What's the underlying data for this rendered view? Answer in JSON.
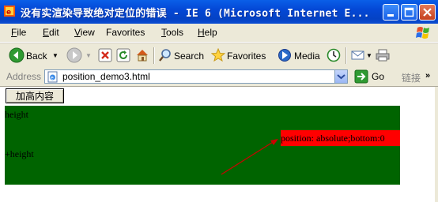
{
  "window": {
    "title": "没有实渲染导致绝对定位的错误 - IE 6 (Microsoft Internet E..."
  },
  "menu": {
    "items": [
      {
        "accel": "F",
        "rest": "ile"
      },
      {
        "accel": "E",
        "rest": "dit"
      },
      {
        "accel": "V",
        "rest": "iew"
      },
      {
        "accel": "",
        "rest": "Favorites"
      },
      {
        "accel": "T",
        "rest": "ools"
      },
      {
        "accel": "H",
        "rest": "elp"
      }
    ]
  },
  "toolbar": {
    "back_label": "Back",
    "search_label": "Search",
    "favorites_label": "Favorites",
    "media_label": "Media"
  },
  "address": {
    "label": "Address",
    "value": "position_demo3.html",
    "go_label": "Go",
    "links_label": "链接"
  },
  "page": {
    "button_label": "加高内容",
    "text_height": "height",
    "text_plus_height": "+height",
    "red_label": "position: absolute;bottom:0"
  },
  "colors": {
    "green_box": "#006400",
    "red_box": "#ff0000",
    "arrow": "#cc0000"
  }
}
